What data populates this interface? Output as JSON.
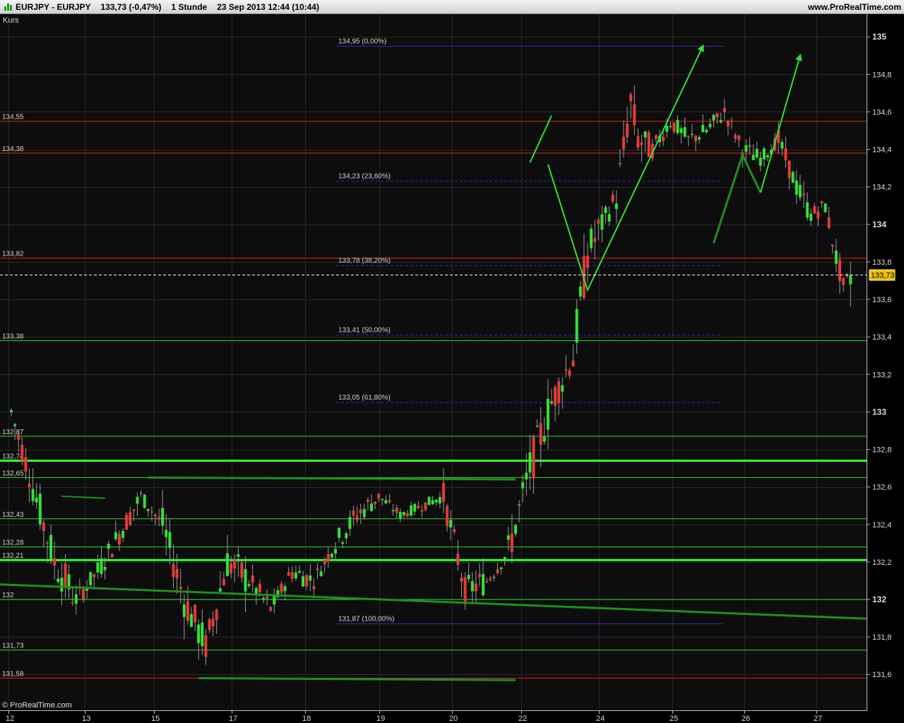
{
  "header": {
    "symbol": "EURJPY - EURJPY",
    "quote": "133,73 (-0,47%)",
    "timeframe": "1 Stunde",
    "datetime": "23 Sep 2013 12:44 (10:44)",
    "brand": "www.ProRealTime.com"
  },
  "panel_label": "Kurs",
  "credit": "© ProRealTime.com",
  "last_price_label": "133,73",
  "chart_data": {
    "type": "candlestick",
    "ylim": [
      131.47,
      135.1
    ],
    "y_ticks": [
      {
        "value": 135,
        "label": "135",
        "major": true
      },
      {
        "value": 134.8,
        "label": "134,8"
      },
      {
        "value": 134.6,
        "label": "134,6"
      },
      {
        "value": 134.4,
        "label": "134,4"
      },
      {
        "value": 134.2,
        "label": "134,2"
      },
      {
        "value": 134,
        "label": "134",
        "major": true
      },
      {
        "value": 133.8,
        "label": "133,8"
      },
      {
        "value": 133.6,
        "label": "133,6"
      },
      {
        "value": 133.4,
        "label": "133,4"
      },
      {
        "value": 133.2,
        "label": "133,2"
      },
      {
        "value": 133,
        "label": "133",
        "major": true
      },
      {
        "value": 132.8,
        "label": "132,8"
      },
      {
        "value": 132.6,
        "label": "132,6"
      },
      {
        "value": 132.4,
        "label": "132,4"
      },
      {
        "value": 132.2,
        "label": "132,2"
      },
      {
        "value": 132,
        "label": "132",
        "major": true
      },
      {
        "value": 131.8,
        "label": "131,8"
      },
      {
        "value": 131.6,
        "label": "131,6"
      }
    ],
    "x_labels": [
      "12",
      "13",
      "15",
      "17",
      "18",
      "19",
      "20",
      "22",
      "24",
      "25",
      "26",
      "27"
    ],
    "last_price": 133.73,
    "horizontal_levels": [
      {
        "value": 134.55,
        "label": "134,55",
        "color": "#e0201c",
        "weight": 1
      },
      {
        "value": 134.38,
        "label": "134,38",
        "color": "#e0201c",
        "weight": 1
      },
      {
        "value": 133.82,
        "label": "133,82",
        "color": "#e0201c",
        "weight": 1
      },
      {
        "value": 133.38,
        "label": "133,38",
        "color": "#2fd82f",
        "weight": 1
      },
      {
        "value": 132.87,
        "label": "132,87",
        "color": "#2fd82f",
        "weight": 1
      },
      {
        "value": 132.74,
        "label": "132,74",
        "color": "#33ff33",
        "weight": 3
      },
      {
        "value": 132.65,
        "label": "132,65",
        "color": "#2fd82f",
        "weight": 1
      },
      {
        "value": 132.43,
        "label": "132,43",
        "color": "#2fd82f",
        "weight": 1
      },
      {
        "value": 132.28,
        "label": "132,28",
        "color": "#2fd82f",
        "weight": 1
      },
      {
        "value": 132.21,
        "label": "132,21",
        "color": "#33ff33",
        "weight": 3
      },
      {
        "value": 132,
        "label": "132",
        "color": "#2fd82f",
        "weight": 1
      },
      {
        "value": 131.73,
        "label": "131,73",
        "color": "#2fd82f",
        "weight": 1
      },
      {
        "value": 131.58,
        "label": "131,58",
        "color": "#e0201c",
        "weight": 1
      }
    ],
    "fibonacci": {
      "color": "#2828c8",
      "levels": [
        {
          "value": 134.95,
          "label": "134,95 (0,00%)"
        },
        {
          "value": 134.23,
          "label": "134,23 (23,60%)"
        },
        {
          "value": 133.78,
          "label": "133,78 (38,20%)"
        },
        {
          "value": 133.41,
          "label": "133,41 (50,00%)"
        },
        {
          "value": 133.05,
          "label": "133,05 (61,80%)"
        },
        {
          "value": 131.87,
          "label": "131,87 (100,00%)"
        }
      ]
    },
    "ohlc_anchors": [
      [
        0,
        132.9,
        133.1,
        132.8,
        133.0
      ],
      [
        6,
        132.8,
        132.9,
        132.5,
        132.6
      ],
      [
        12,
        132.5,
        132.7,
        132.1,
        132.2
      ],
      [
        18,
        132.1,
        132.3,
        131.9,
        132.0
      ],
      [
        24,
        131.95,
        132.2,
        131.9,
        132.15
      ],
      [
        30,
        132.2,
        132.4,
        132.1,
        132.35
      ],
      [
        36,
        132.4,
        132.6,
        132.3,
        132.55
      ],
      [
        42,
        132.6,
        132.65,
        132.35,
        132.4
      ],
      [
        48,
        132.35,
        132.45,
        131.9,
        132.0
      ],
      [
        54,
        131.8,
        132.1,
        131.62,
        131.75
      ],
      [
        60,
        131.9,
        132.3,
        131.6,
        132.2
      ],
      [
        66,
        132.2,
        132.4,
        132.0,
        132.1
      ],
      [
        72,
        132.0,
        132.15,
        131.9,
        131.95
      ],
      [
        78,
        131.95,
        132.2,
        131.85,
        132.15
      ],
      [
        84,
        132.15,
        132.3,
        132.05,
        132.1
      ],
      [
        90,
        132.1,
        132.35,
        132.0,
        132.3
      ],
      [
        96,
        132.3,
        132.5,
        132.2,
        132.45
      ],
      [
        102,
        132.45,
        132.65,
        132.4,
        132.55
      ],
      [
        108,
        132.55,
        132.6,
        132.4,
        132.45
      ],
      [
        114,
        132.45,
        132.55,
        132.38,
        132.5
      ],
      [
        120,
        132.5,
        132.6,
        132.35,
        132.55
      ],
      [
        126,
        132.5,
        132.55,
        131.98,
        132.05
      ],
      [
        132,
        132.05,
        132.25,
        131.95,
        132.1
      ],
      [
        138,
        132.1,
        132.3,
        131.95,
        132.25
      ],
      [
        144,
        132.3,
        132.75,
        132.2,
        132.7
      ],
      [
        150,
        132.75,
        133.1,
        132.7,
        133.05
      ],
      [
        156,
        133.05,
        133.4,
        133.0,
        133.3
      ],
      [
        160,
        133.3,
        134.0,
        133.25,
        133.85
      ],
      [
        164,
        133.85,
        134.1,
        133.8,
        134.0
      ],
      [
        168,
        134.0,
        134.3,
        133.95,
        134.15
      ],
      [
        172,
        134.15,
        134.7,
        134.1,
        134.65
      ],
      [
        174,
        134.65,
        134.95,
        134.35,
        134.45
      ],
      [
        178,
        134.45,
        134.7,
        134.3,
        134.4
      ],
      [
        183,
        134.4,
        134.6,
        134.3,
        134.55
      ],
      [
        188,
        134.55,
        134.7,
        134.4,
        134.45
      ],
      [
        193,
        134.45,
        134.6,
        134.3,
        134.5
      ],
      [
        198,
        134.5,
        134.7,
        134.35,
        134.6
      ],
      [
        203,
        134.6,
        134.7,
        134.35,
        134.4
      ],
      [
        208,
        134.4,
        134.5,
        134.3,
        134.35
      ],
      [
        213,
        134.35,
        134.55,
        134.25,
        134.45
      ],
      [
        218,
        134.4,
        134.45,
        134.1,
        134.2
      ],
      [
        222,
        134.2,
        134.25,
        133.95,
        134.05
      ],
      [
        226,
        134.05,
        134.15,
        133.9,
        134.1
      ],
      [
        229,
        134.1,
        134.15,
        133.75,
        133.82
      ],
      [
        231,
        133.82,
        133.85,
        133.62,
        133.68
      ],
      [
        233,
        133.68,
        133.8,
        133.56,
        133.73
      ]
    ],
    "annotations": {
      "dark_green": "#1f8f1f",
      "bright_green": "#33e033",
      "lines": [
        {
          "color": "dark",
          "w": 3,
          "pts": [
            [
              -16,
              132.09
            ],
            [
              300,
              131.85
            ]
          ]
        },
        {
          "color": "dark",
          "w": 3,
          "pts": [
            [
              38,
              132.65
            ],
            [
              140,
              132.64
            ]
          ]
        },
        {
          "color": "dark",
          "w": 3,
          "pts": [
            [
              52,
              131.58
            ],
            [
              140,
              131.57
            ]
          ]
        },
        {
          "color": "dark",
          "w": 2,
          "pts": [
            [
              14,
              132.55
            ],
            [
              26,
              132.54
            ]
          ]
        },
        {
          "color": "bright",
          "w": 2,
          "pts": [
            [
              144,
              134.33
            ],
            [
              150,
              134.58
            ]
          ]
        },
        {
          "color": "bright",
          "w": 2,
          "pts": [
            [
              149,
              134.32
            ],
            [
              160,
              133.65
            ],
            [
              192,
              134.95
            ]
          ],
          "arrow": true
        },
        {
          "color": "dark",
          "w": 3,
          "pts": [
            [
              195,
              133.9
            ],
            [
              203,
              134.37
            ],
            [
              208,
              134.17
            ]
          ]
        },
        {
          "color": "bright",
          "w": 2,
          "pts": [
            [
              208,
              134.17
            ],
            [
              219,
              134.9
            ]
          ],
          "arrow": true
        }
      ]
    }
  }
}
